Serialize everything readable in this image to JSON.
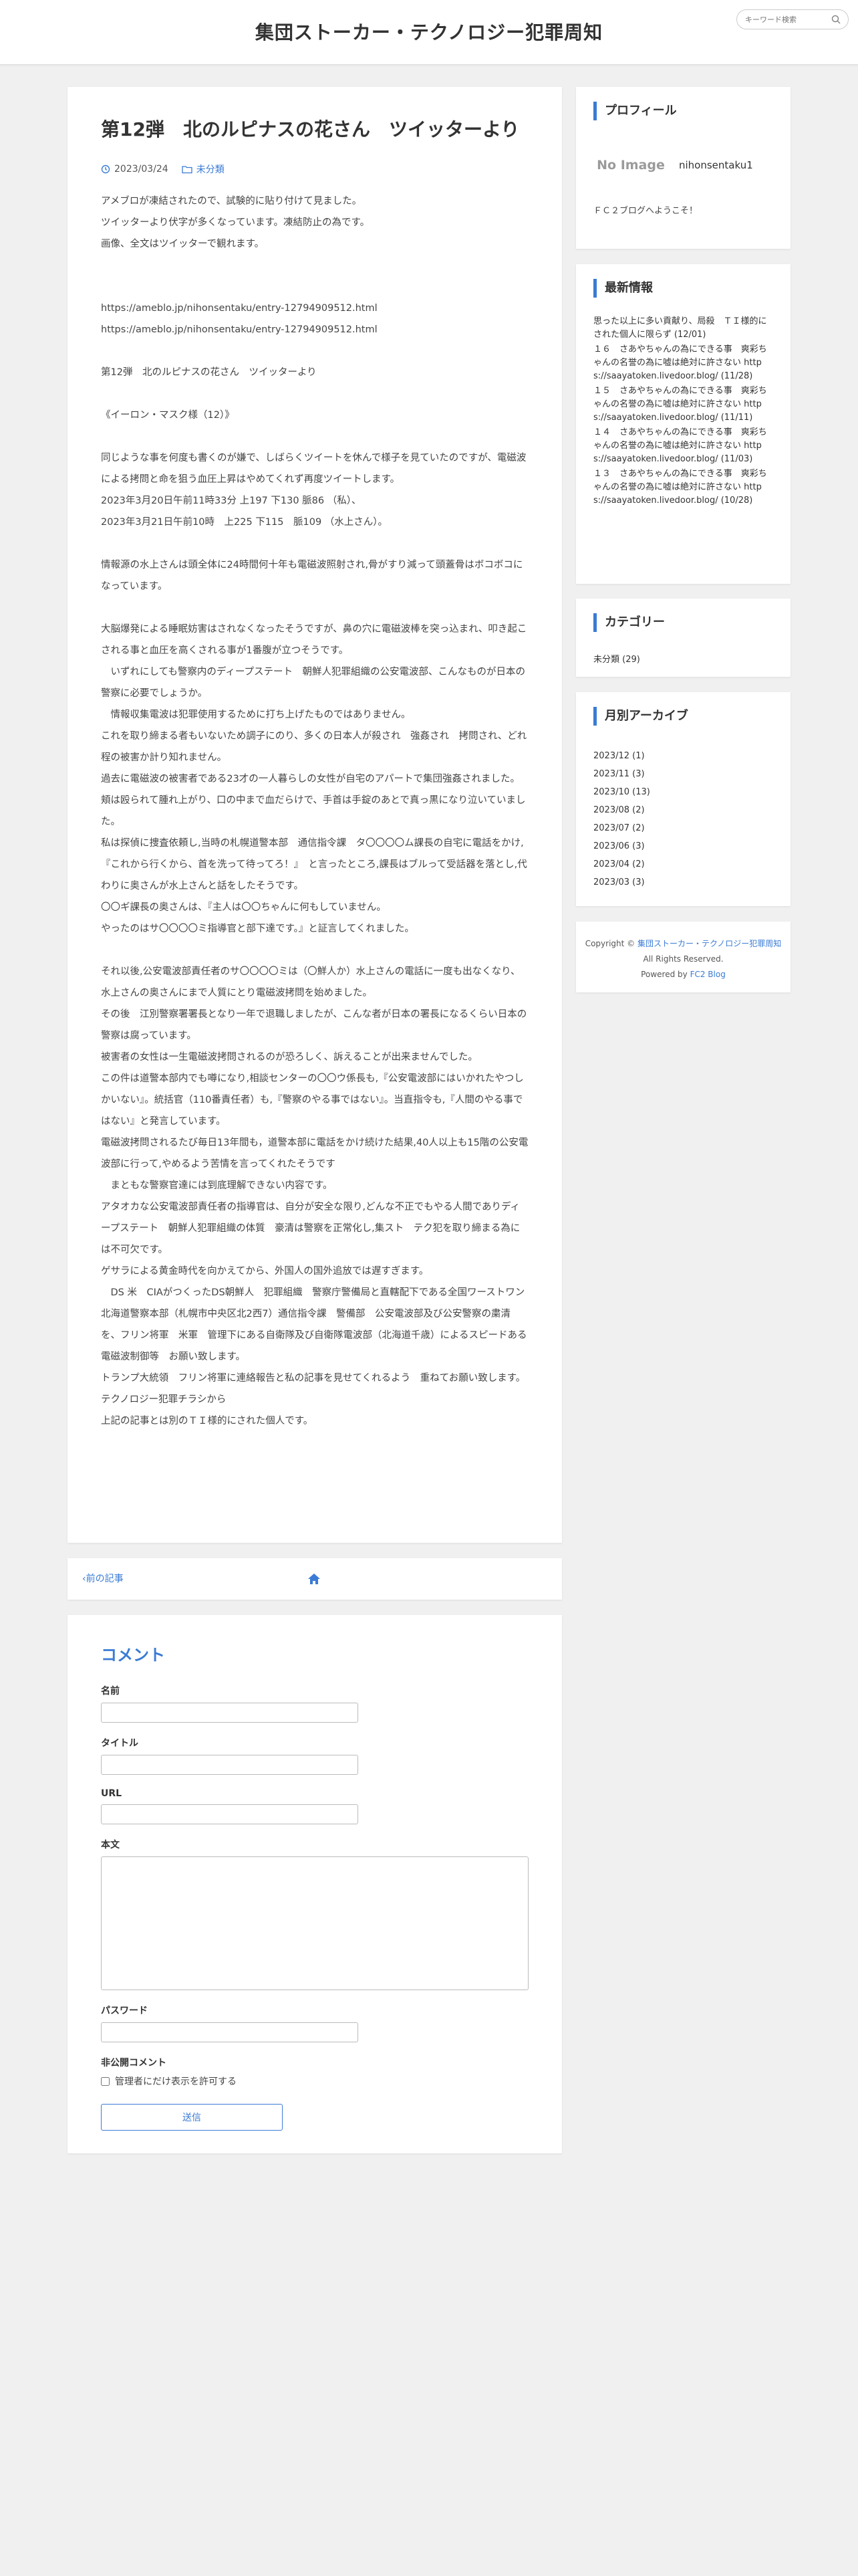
{
  "site": {
    "title": "集団ストーカー・テクノロジー犯罪周知",
    "search_placeholder": "キーワード検索"
  },
  "article": {
    "title": "第12弾　北のルピナスの花さん　ツイッターより",
    "date": "2023/03/24",
    "category": "未分類",
    "paragraphs": [
      "アメブロが凍結されたので、試験的に貼り付けて見ました。",
      "ツイッターより伏字が多くなっています。凍結防止の為です。",
      "画像、全文はツイッターで観れます。",
      "",
      "",
      "https://ameblo.jp/nihonsentaku/entry-12794909512.html",
      "https://ameblo.jp/nihonsentaku/entry-12794909512.html",
      "",
      "第12弾　北のルピナスの花さん　ツイッターより",
      "",
      "《イーロン・マスク様（12）》",
      "",
      "同じような事を何度も書くのが嫌で、しばらくツイートを休んで様子を見ていたのですが、電磁波による拷問と命を狙う血圧上昇はやめてくれず再度ツイートします。",
      "2023年3月20日午前11時33分 上197 下130 脈86 （私）、",
      "2023年3月21日午前10時　上225 下115　脈109 （水上さん）。",
      "",
      "情報源の水上さんは頭全体に24時間何十年も電磁波照射され,骨がすり減って頭蓋骨はボコボコになっています。",
      "",
      "大脳爆発による睡眠妨害はされなくなったそうですが、鼻の穴に電磁波棒を突っ込まれ、叩き起こされる事と血圧を高くされる事が1番腹が立つそうです。",
      "　いずれにしても警察内のディープステート　朝鮮人犯罪組織の公安電波部、こんなものが日本の警察に必要でしょうか。",
      "　情報収集電波は犯罪使用するために打ち上げたものではありません。",
      "これを取り締まる者もいないため調子にのり、多くの日本人が殺され　強姦され　拷問され、どれ程の被害か計り知れません。",
      "過去に電磁波の被害者である23才の一人暮らしの女性が自宅のアパートで集団強姦されました。",
      "頬は殴られて腫れ上がり、口の中まで血だらけで、手首は手錠のあとで真っ黒になり泣いていました。",
      "私は探偵に捜査依頼し,当時の札幌道警本部　通信指令課　タ〇〇〇〇ム課長の自宅に電話をかけ,『これから行くから、首を洗って待ってろ！』　と言ったところ,課長はブルって受話器を落とし,代わりに奥さんが水上さんと話をしたそうです。",
      "〇〇ギ課長の奥さんは、『主人は〇〇ちゃんに何もしていません。",
      "やったのはサ〇〇〇〇ミ指導官と部下達です。』と証言してくれました。",
      "",
      "それ以後,公安電波部責任者のサ〇〇〇〇ミは（〇鮮人か）水上さんの電話に一度も出なくなり、水上さんの奥さんにまで人質にとり電磁波拷問を始めました。",
      "その後　江別警察署署長となり一年で退職しましたが、こんな者が日本の署長になるくらい日本の警察は腐っています。",
      "被害者の女性は一生電磁波拷問されるのが恐ろしく、訴えることが出来ませんでした。",
      "この件は道警本部内でも噂になり,相談センターの〇〇ウ係長も,『公安電波部にはいかれたやつしかいない』。統括官（110番責任者）も,『警察のやる事ではない』。当直指令も,『人間のやる事ではない』と発言しています。",
      "電磁波拷問されるたび毎日13年間も，道警本部に電話をかけ続けた結果,40人以上も15階の公安電波部に行って,やめるよう苦情を言ってくれたそうです",
      "　まともな警察官達には到底理解できない内容です。",
      "アタオカな公安電波部責任者の指導官は、自分が安全な限り,どんな不正でもやる人間でありディープステート　朝鮮人犯罪組織の体質　豪清は警察を正常化し,集スト　テク犯を取り締まる為には不可欠です。",
      "ゲサラによる黄金時代を向かえてから、外国人の国外追放では遅すぎます。",
      "　DS 米　CIAがつくったDS朝鮮人　犯罪組織　警察庁警備局と直轄配下である全国ワーストワン北海道警察本部（札幌市中央区北2西7）通信指令課　警備部　公安電波部及び公安警察の粛清を、フリン将軍　米軍　管理下にある自衛隊及び自衛隊電波部（北海道千歳）によるスピードある電磁波制御等　お願い致します。",
      "トランプ大統領　フリン将軍に連絡報告と私の記事を見せてくれるよう　重ねてお願い致します。",
      "テクノロジー犯罪チラシから",
      "上記の記事とは別のＴＩ様的にされた個人です。"
    ]
  },
  "pager": {
    "prev_label": "前の記事"
  },
  "comments": {
    "heading": "コメント",
    "name_label": "名前",
    "title_label": "タイトル",
    "url_label": "URL",
    "body_label": "本文",
    "password_label": "パスワード",
    "secret_label": "非公開コメント",
    "secret_option": "管理者にだけ表示を許可する",
    "submit_label": "送信"
  },
  "sidebar": {
    "profile": {
      "heading": "プロフィール",
      "noimage": "No Image",
      "username": "nihonsentaku1",
      "description": "ＦＣ２ブログへようこそ！"
    },
    "latest": {
      "heading": "最新情報",
      "items": [
        "思った以上に多い貢献り、局殺　ＴＩ様的にされた個人に限らず (12/01)",
        "１６　さあやちゃんの為にできる事　爽彩ちゃんの名誉の為に嘘は絶対に許さない https://saayatoken.livedoor.blog/ (11/28)",
        "１５　さあやちゃんの為にできる事　爽彩ちゃんの名誉の為に嘘は絶対に許さない https://saayatoken.livedoor.blog/ (11/11)",
        "１４　さあやちゃんの為にできる事　爽彩ちゃんの名誉の為に嘘は絶対に許さない https://saayatoken.livedoor.blog/ (11/03)",
        "１３　さあやちゃんの為にできる事　爽彩ちゃんの名誉の為に嘘は絶対に許さない https://saayatoken.livedoor.blog/ (10/28)"
      ]
    },
    "category": {
      "heading": "カテゴリー",
      "items": [
        "未分類 (29)"
      ]
    },
    "archive": {
      "heading": "月別アーカイブ",
      "items": [
        "2023/12 (1)",
        "2023/11 (3)",
        "2023/10 (13)",
        "2023/08 (2)",
        "2023/07 (2)",
        "2023/06 (3)",
        "2023/04 (2)",
        "2023/03 (3)"
      ]
    },
    "footer": {
      "copyright_prefix": "Copyright ©",
      "copyright_link": "集団ストーカー・テクノロジー犯罪周知",
      "rights": "All Rights Reserved.",
      "powered_prefix": "Powered by",
      "powered_link": "FC2 Blog"
    }
  },
  "colors": {
    "accent": "#3a7bd5",
    "background": "#f0f0f0"
  }
}
